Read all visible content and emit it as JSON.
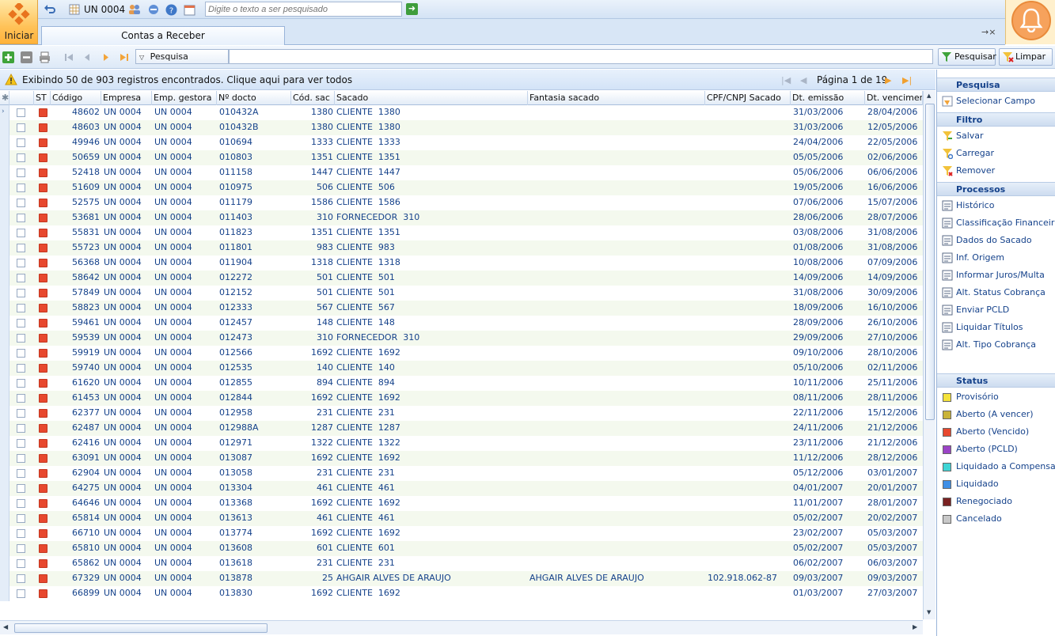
{
  "toolbar": {
    "start_label": "Iniciar",
    "unit_label": "UN 0004",
    "search_placeholder": "Digite o texto a ser pesquisado"
  },
  "tabs": [
    {
      "label": "Contas a Receber"
    }
  ],
  "tab_controls": "→×",
  "gridbar": {
    "field_select": "Pesquisa",
    "search_value": "",
    "search_button": "Pesquisar",
    "clear_button": "Limpar"
  },
  "info": {
    "message": "Exibindo 50 de 903 registros encontrados. Clique aqui para ver todos",
    "page_label": "Página 1 de 19"
  },
  "columns": [
    "ST",
    "Código",
    "Empresa",
    "Emp. gestora",
    "Nº docto",
    "Cód. sac",
    "Sacado",
    "Fantasia sacado",
    "CPF/CNPJ Sacado",
    "Dt. emissão",
    "Dt. venciment"
  ],
  "rows": [
    {
      "codigo": "48602",
      "empresa": "UN 0004",
      "gestora": "UN 0004",
      "docto": "010432A",
      "codsac": "1380",
      "sacado": "CLIENTE  1380",
      "fantasia": "",
      "cpf": "",
      "emissao": "31/03/2006",
      "venc": "28/04/2006"
    },
    {
      "codigo": "48603",
      "empresa": "UN 0004",
      "gestora": "UN 0004",
      "docto": "010432B",
      "codsac": "1380",
      "sacado": "CLIENTE  1380",
      "fantasia": "",
      "cpf": "",
      "emissao": "31/03/2006",
      "venc": "12/05/2006"
    },
    {
      "codigo": "49946",
      "empresa": "UN 0004",
      "gestora": "UN 0004",
      "docto": "010694",
      "codsac": "1333",
      "sacado": "CLIENTE  1333",
      "fantasia": "",
      "cpf": "",
      "emissao": "24/04/2006",
      "venc": "22/05/2006"
    },
    {
      "codigo": "50659",
      "empresa": "UN 0004",
      "gestora": "UN 0004",
      "docto": "010803",
      "codsac": "1351",
      "sacado": "CLIENTE  1351",
      "fantasia": "",
      "cpf": "",
      "emissao": "05/05/2006",
      "venc": "02/06/2006"
    },
    {
      "codigo": "52418",
      "empresa": "UN 0004",
      "gestora": "UN 0004",
      "docto": "011158",
      "codsac": "1447",
      "sacado": "CLIENTE  1447",
      "fantasia": "",
      "cpf": "",
      "emissao": "05/06/2006",
      "venc": "06/06/2006"
    },
    {
      "codigo": "51609",
      "empresa": "UN 0004",
      "gestora": "UN 0004",
      "docto": "010975",
      "codsac": "506",
      "sacado": "CLIENTE  506",
      "fantasia": "",
      "cpf": "",
      "emissao": "19/05/2006",
      "venc": "16/06/2006"
    },
    {
      "codigo": "52575",
      "empresa": "UN 0004",
      "gestora": "UN 0004",
      "docto": "011179",
      "codsac": "1586",
      "sacado": "CLIENTE  1586",
      "fantasia": "",
      "cpf": "",
      "emissao": "07/06/2006",
      "venc": "15/07/2006"
    },
    {
      "codigo": "53681",
      "empresa": "UN 0004",
      "gestora": "UN 0004",
      "docto": "011403",
      "codsac": "310",
      "sacado": "FORNECEDOR  310",
      "fantasia": "",
      "cpf": "",
      "emissao": "28/06/2006",
      "venc": "28/07/2006"
    },
    {
      "codigo": "55831",
      "empresa": "UN 0004",
      "gestora": "UN 0004",
      "docto": "011823",
      "codsac": "1351",
      "sacado": "CLIENTE  1351",
      "fantasia": "",
      "cpf": "",
      "emissao": "03/08/2006",
      "venc": "31/08/2006"
    },
    {
      "codigo": "55723",
      "empresa": "UN 0004",
      "gestora": "UN 0004",
      "docto": "011801",
      "codsac": "983",
      "sacado": "CLIENTE  983",
      "fantasia": "",
      "cpf": "",
      "emissao": "01/08/2006",
      "venc": "31/08/2006"
    },
    {
      "codigo": "56368",
      "empresa": "UN 0004",
      "gestora": "UN 0004",
      "docto": "011904",
      "codsac": "1318",
      "sacado": "CLIENTE  1318",
      "fantasia": "",
      "cpf": "",
      "emissao": "10/08/2006",
      "venc": "07/09/2006"
    },
    {
      "codigo": "58642",
      "empresa": "UN 0004",
      "gestora": "UN 0004",
      "docto": "012272",
      "codsac": "501",
      "sacado": "CLIENTE  501",
      "fantasia": "",
      "cpf": "",
      "emissao": "14/09/2006",
      "venc": "14/09/2006"
    },
    {
      "codigo": "57849",
      "empresa": "UN 0004",
      "gestora": "UN 0004",
      "docto": "012152",
      "codsac": "501",
      "sacado": "CLIENTE  501",
      "fantasia": "",
      "cpf": "",
      "emissao": "31/08/2006",
      "venc": "30/09/2006"
    },
    {
      "codigo": "58823",
      "empresa": "UN 0004",
      "gestora": "UN 0004",
      "docto": "012333",
      "codsac": "567",
      "sacado": "CLIENTE  567",
      "fantasia": "",
      "cpf": "",
      "emissao": "18/09/2006",
      "venc": "16/10/2006"
    },
    {
      "codigo": "59461",
      "empresa": "UN 0004",
      "gestora": "UN 0004",
      "docto": "012457",
      "codsac": "148",
      "sacado": "CLIENTE  148",
      "fantasia": "",
      "cpf": "",
      "emissao": "28/09/2006",
      "venc": "26/10/2006"
    },
    {
      "codigo": "59539",
      "empresa": "UN 0004",
      "gestora": "UN 0004",
      "docto": "012473",
      "codsac": "310",
      "sacado": "FORNECEDOR  310",
      "fantasia": "",
      "cpf": "",
      "emissao": "29/09/2006",
      "venc": "27/10/2006"
    },
    {
      "codigo": "59919",
      "empresa": "UN 0004",
      "gestora": "UN 0004",
      "docto": "012566",
      "codsac": "1692",
      "sacado": "CLIENTE  1692",
      "fantasia": "",
      "cpf": "",
      "emissao": "09/10/2006",
      "venc": "28/10/2006"
    },
    {
      "codigo": "59740",
      "empresa": "UN 0004",
      "gestora": "UN 0004",
      "docto": "012535",
      "codsac": "140",
      "sacado": "CLIENTE  140",
      "fantasia": "",
      "cpf": "",
      "emissao": "05/10/2006",
      "venc": "02/11/2006"
    },
    {
      "codigo": "61620",
      "empresa": "UN 0004",
      "gestora": "UN 0004",
      "docto": "012855",
      "codsac": "894",
      "sacado": "CLIENTE  894",
      "fantasia": "",
      "cpf": "",
      "emissao": "10/11/2006",
      "venc": "25/11/2006"
    },
    {
      "codigo": "61453",
      "empresa": "UN 0004",
      "gestora": "UN 0004",
      "docto": "012844",
      "codsac": "1692",
      "sacado": "CLIENTE  1692",
      "fantasia": "",
      "cpf": "",
      "emissao": "08/11/2006",
      "venc": "28/11/2006"
    },
    {
      "codigo": "62377",
      "empresa": "UN 0004",
      "gestora": "UN 0004",
      "docto": "012958",
      "codsac": "231",
      "sacado": "CLIENTE  231",
      "fantasia": "",
      "cpf": "",
      "emissao": "22/11/2006",
      "venc": "15/12/2006"
    },
    {
      "codigo": "62487",
      "empresa": "UN 0004",
      "gestora": "UN 0004",
      "docto": "012988A",
      "codsac": "1287",
      "sacado": "CLIENTE  1287",
      "fantasia": "",
      "cpf": "",
      "emissao": "24/11/2006",
      "venc": "21/12/2006"
    },
    {
      "codigo": "62416",
      "empresa": "UN 0004",
      "gestora": "UN 0004",
      "docto": "012971",
      "codsac": "1322",
      "sacado": "CLIENTE  1322",
      "fantasia": "",
      "cpf": "",
      "emissao": "23/11/2006",
      "venc": "21/12/2006"
    },
    {
      "codigo": "63091",
      "empresa": "UN 0004",
      "gestora": "UN 0004",
      "docto": "013087",
      "codsac": "1692",
      "sacado": "CLIENTE  1692",
      "fantasia": "",
      "cpf": "",
      "emissao": "11/12/2006",
      "venc": "28/12/2006"
    },
    {
      "codigo": "62904",
      "empresa": "UN 0004",
      "gestora": "UN 0004",
      "docto": "013058",
      "codsac": "231",
      "sacado": "CLIENTE  231",
      "fantasia": "",
      "cpf": "",
      "emissao": "05/12/2006",
      "venc": "03/01/2007"
    },
    {
      "codigo": "64275",
      "empresa": "UN 0004",
      "gestora": "UN 0004",
      "docto": "013304",
      "codsac": "461",
      "sacado": "CLIENTE  461",
      "fantasia": "",
      "cpf": "",
      "emissao": "04/01/2007",
      "venc": "20/01/2007"
    },
    {
      "codigo": "64646",
      "empresa": "UN 0004",
      "gestora": "UN 0004",
      "docto": "013368",
      "codsac": "1692",
      "sacado": "CLIENTE  1692",
      "fantasia": "",
      "cpf": "",
      "emissao": "11/01/2007",
      "venc": "28/01/2007"
    },
    {
      "codigo": "65814",
      "empresa": "UN 0004",
      "gestora": "UN 0004",
      "docto": "013613",
      "codsac": "461",
      "sacado": "CLIENTE  461",
      "fantasia": "",
      "cpf": "",
      "emissao": "05/02/2007",
      "venc": "20/02/2007"
    },
    {
      "codigo": "66710",
      "empresa": "UN 0004",
      "gestora": "UN 0004",
      "docto": "013774",
      "codsac": "1692",
      "sacado": "CLIENTE  1692",
      "fantasia": "",
      "cpf": "",
      "emissao": "23/02/2007",
      "venc": "05/03/2007"
    },
    {
      "codigo": "65810",
      "empresa": "UN 0004",
      "gestora": "UN 0004",
      "docto": "013608",
      "codsac": "601",
      "sacado": "CLIENTE  601",
      "fantasia": "",
      "cpf": "",
      "emissao": "05/02/2007",
      "venc": "05/03/2007"
    },
    {
      "codigo": "65862",
      "empresa": "UN 0004",
      "gestora": "UN 0004",
      "docto": "013618",
      "codsac": "231",
      "sacado": "CLIENTE  231",
      "fantasia": "",
      "cpf": "",
      "emissao": "06/02/2007",
      "venc": "06/03/2007"
    },
    {
      "codigo": "67329",
      "empresa": "UN 0004",
      "gestora": "UN 0004",
      "docto": "013878",
      "codsac": "25",
      "sacado": "AHGAIR ALVES DE ARAUJO",
      "fantasia": "AHGAIR ALVES DE ARAUJO",
      "cpf": "102.918.062-87",
      "emissao": "09/03/2007",
      "venc": "09/03/2007"
    },
    {
      "codigo": "66899",
      "empresa": "UN 0004",
      "gestora": "UN 0004",
      "docto": "013830",
      "codsac": "1692",
      "sacado": "CLIENTE  1692",
      "fantasia": "",
      "cpf": "",
      "emissao": "01/03/2007",
      "venc": "27/03/2007"
    }
  ],
  "side": {
    "pesquisa_title": "Pesquisa",
    "pesquisa_items": [
      "Selecionar Campo"
    ],
    "filtro_title": "Filtro",
    "filtro_items": [
      "Salvar",
      "Carregar",
      "Remover"
    ],
    "processos_title": "Processos",
    "processos_items": [
      "Histórico",
      "Classificação Financeira",
      "Dados do Sacado",
      "Inf. Origem",
      "Informar Juros/Multa",
      "Alt. Status Cobrança",
      "Enviar PCLD",
      "Liquidar Títulos",
      "Alt. Tipo Cobrança"
    ],
    "status_title": "Status",
    "status_items": [
      {
        "label": "Provisório",
        "color": "#f4e23a"
      },
      {
        "label": "Aberto (A vencer)",
        "color": "#c9b338"
      },
      {
        "label": "Aberto (Vencido)",
        "color": "#e7482e"
      },
      {
        "label": "Aberto (PCLD)",
        "color": "#9b44c6"
      },
      {
        "label": "Liquidado a Compensar",
        "color": "#3fd4d4"
      },
      {
        "label": "Liquidado",
        "color": "#3f8fe6"
      },
      {
        "label": "Renegociado",
        "color": "#7a2222"
      },
      {
        "label": "Cancelado",
        "color": "#c8c8c8"
      }
    ]
  }
}
